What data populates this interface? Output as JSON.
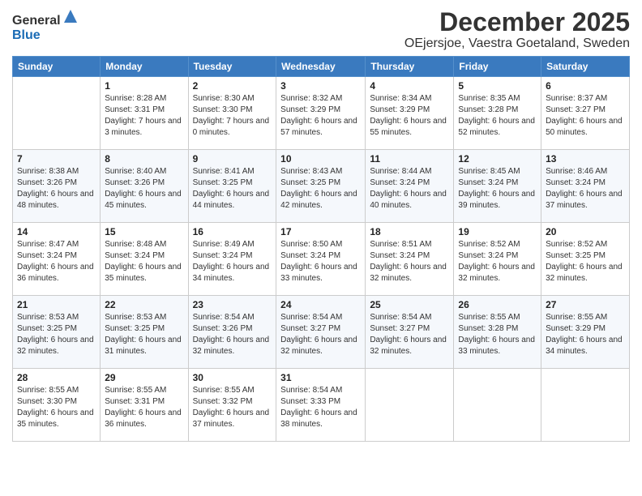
{
  "header": {
    "logo_general": "General",
    "logo_blue": "Blue",
    "month_title": "December 2025",
    "location": "OEjersjoe, Vaestra Goetaland, Sweden"
  },
  "days_of_week": [
    "Sunday",
    "Monday",
    "Tuesday",
    "Wednesday",
    "Thursday",
    "Friday",
    "Saturday"
  ],
  "weeks": [
    [
      {
        "day": "",
        "sunrise": "",
        "sunset": "",
        "daylight": ""
      },
      {
        "day": "1",
        "sunrise": "Sunrise: 8:28 AM",
        "sunset": "Sunset: 3:31 PM",
        "daylight": "Daylight: 7 hours and 3 minutes."
      },
      {
        "day": "2",
        "sunrise": "Sunrise: 8:30 AM",
        "sunset": "Sunset: 3:30 PM",
        "daylight": "Daylight: 7 hours and 0 minutes."
      },
      {
        "day": "3",
        "sunrise": "Sunrise: 8:32 AM",
        "sunset": "Sunset: 3:29 PM",
        "daylight": "Daylight: 6 hours and 57 minutes."
      },
      {
        "day": "4",
        "sunrise": "Sunrise: 8:34 AM",
        "sunset": "Sunset: 3:29 PM",
        "daylight": "Daylight: 6 hours and 55 minutes."
      },
      {
        "day": "5",
        "sunrise": "Sunrise: 8:35 AM",
        "sunset": "Sunset: 3:28 PM",
        "daylight": "Daylight: 6 hours and 52 minutes."
      },
      {
        "day": "6",
        "sunrise": "Sunrise: 8:37 AM",
        "sunset": "Sunset: 3:27 PM",
        "daylight": "Daylight: 6 hours and 50 minutes."
      }
    ],
    [
      {
        "day": "7",
        "sunrise": "Sunrise: 8:38 AM",
        "sunset": "Sunset: 3:26 PM",
        "daylight": "Daylight: 6 hours and 48 minutes."
      },
      {
        "day": "8",
        "sunrise": "Sunrise: 8:40 AM",
        "sunset": "Sunset: 3:26 PM",
        "daylight": "Daylight: 6 hours and 45 minutes."
      },
      {
        "day": "9",
        "sunrise": "Sunrise: 8:41 AM",
        "sunset": "Sunset: 3:25 PM",
        "daylight": "Daylight: 6 hours and 44 minutes."
      },
      {
        "day": "10",
        "sunrise": "Sunrise: 8:43 AM",
        "sunset": "Sunset: 3:25 PM",
        "daylight": "Daylight: 6 hours and 42 minutes."
      },
      {
        "day": "11",
        "sunrise": "Sunrise: 8:44 AM",
        "sunset": "Sunset: 3:24 PM",
        "daylight": "Daylight: 6 hours and 40 minutes."
      },
      {
        "day": "12",
        "sunrise": "Sunrise: 8:45 AM",
        "sunset": "Sunset: 3:24 PM",
        "daylight": "Daylight: 6 hours and 39 minutes."
      },
      {
        "day": "13",
        "sunrise": "Sunrise: 8:46 AM",
        "sunset": "Sunset: 3:24 PM",
        "daylight": "Daylight: 6 hours and 37 minutes."
      }
    ],
    [
      {
        "day": "14",
        "sunrise": "Sunrise: 8:47 AM",
        "sunset": "Sunset: 3:24 PM",
        "daylight": "Daylight: 6 hours and 36 minutes."
      },
      {
        "day": "15",
        "sunrise": "Sunrise: 8:48 AM",
        "sunset": "Sunset: 3:24 PM",
        "daylight": "Daylight: 6 hours and 35 minutes."
      },
      {
        "day": "16",
        "sunrise": "Sunrise: 8:49 AM",
        "sunset": "Sunset: 3:24 PM",
        "daylight": "Daylight: 6 hours and 34 minutes."
      },
      {
        "day": "17",
        "sunrise": "Sunrise: 8:50 AM",
        "sunset": "Sunset: 3:24 PM",
        "daylight": "Daylight: 6 hours and 33 minutes."
      },
      {
        "day": "18",
        "sunrise": "Sunrise: 8:51 AM",
        "sunset": "Sunset: 3:24 PM",
        "daylight": "Daylight: 6 hours and 32 minutes."
      },
      {
        "day": "19",
        "sunrise": "Sunrise: 8:52 AM",
        "sunset": "Sunset: 3:24 PM",
        "daylight": "Daylight: 6 hours and 32 minutes."
      },
      {
        "day": "20",
        "sunrise": "Sunrise: 8:52 AM",
        "sunset": "Sunset: 3:25 PM",
        "daylight": "Daylight: 6 hours and 32 minutes."
      }
    ],
    [
      {
        "day": "21",
        "sunrise": "Sunrise: 8:53 AM",
        "sunset": "Sunset: 3:25 PM",
        "daylight": "Daylight: 6 hours and 32 minutes."
      },
      {
        "day": "22",
        "sunrise": "Sunrise: 8:53 AM",
        "sunset": "Sunset: 3:25 PM",
        "daylight": "Daylight: 6 hours and 31 minutes."
      },
      {
        "day": "23",
        "sunrise": "Sunrise: 8:54 AM",
        "sunset": "Sunset: 3:26 PM",
        "daylight": "Daylight: 6 hours and 32 minutes."
      },
      {
        "day": "24",
        "sunrise": "Sunrise: 8:54 AM",
        "sunset": "Sunset: 3:27 PM",
        "daylight": "Daylight: 6 hours and 32 minutes."
      },
      {
        "day": "25",
        "sunrise": "Sunrise: 8:54 AM",
        "sunset": "Sunset: 3:27 PM",
        "daylight": "Daylight: 6 hours and 32 minutes."
      },
      {
        "day": "26",
        "sunrise": "Sunrise: 8:55 AM",
        "sunset": "Sunset: 3:28 PM",
        "daylight": "Daylight: 6 hours and 33 minutes."
      },
      {
        "day": "27",
        "sunrise": "Sunrise: 8:55 AM",
        "sunset": "Sunset: 3:29 PM",
        "daylight": "Daylight: 6 hours and 34 minutes."
      }
    ],
    [
      {
        "day": "28",
        "sunrise": "Sunrise: 8:55 AM",
        "sunset": "Sunset: 3:30 PM",
        "daylight": "Daylight: 6 hours and 35 minutes."
      },
      {
        "day": "29",
        "sunrise": "Sunrise: 8:55 AM",
        "sunset": "Sunset: 3:31 PM",
        "daylight": "Daylight: 6 hours and 36 minutes."
      },
      {
        "day": "30",
        "sunrise": "Sunrise: 8:55 AM",
        "sunset": "Sunset: 3:32 PM",
        "daylight": "Daylight: 6 hours and 37 minutes."
      },
      {
        "day": "31",
        "sunrise": "Sunrise: 8:54 AM",
        "sunset": "Sunset: 3:33 PM",
        "daylight": "Daylight: 6 hours and 38 minutes."
      },
      {
        "day": "",
        "sunrise": "",
        "sunset": "",
        "daylight": ""
      },
      {
        "day": "",
        "sunrise": "",
        "sunset": "",
        "daylight": ""
      },
      {
        "day": "",
        "sunrise": "",
        "sunset": "",
        "daylight": ""
      }
    ]
  ]
}
